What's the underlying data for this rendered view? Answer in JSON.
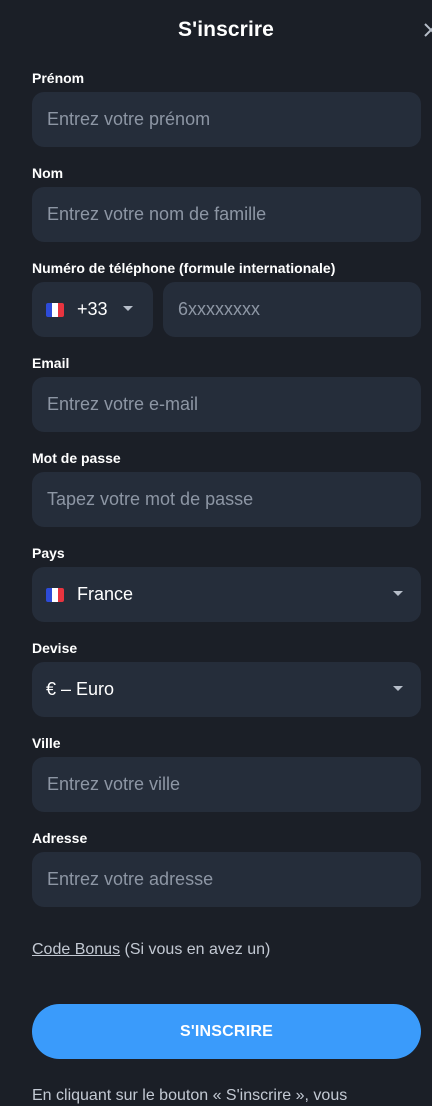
{
  "header": {
    "title": "S'inscrire"
  },
  "form": {
    "first_name": {
      "label": "Prénom",
      "placeholder": "Entrez votre prénom"
    },
    "last_name": {
      "label": "Nom",
      "placeholder": "Entrez votre nom de famille"
    },
    "phone": {
      "label": "Numéro de téléphone (formule internationale)",
      "country_code": "+33",
      "placeholder": "6xxxxxxxx"
    },
    "email": {
      "label": "Email",
      "placeholder": "Entrez votre e-mail"
    },
    "password": {
      "label": "Mot de passe",
      "placeholder": "Tapez votre mot de passe"
    },
    "country": {
      "label": "Pays",
      "value": "France"
    },
    "currency": {
      "label": "Devise",
      "value": "€ – Euro"
    },
    "city": {
      "label": "Ville",
      "placeholder": "Entrez votre ville"
    },
    "address": {
      "label": "Adresse",
      "placeholder": "Entrez votre adresse"
    }
  },
  "bonus": {
    "link": "Code Bonus",
    "note": "(Si vous en avez un)"
  },
  "submit_label": "S'INSCRIRE",
  "terms_text": "En cliquant sur le bouton « S'inscrire », vous",
  "icons": {
    "close": "close-icon",
    "flag": "france-flag-icon",
    "caret": "chevron-down-icon"
  },
  "colors": {
    "background": "#1b1f27",
    "input": "#252d3a",
    "accent": "#3a9bfb"
  }
}
